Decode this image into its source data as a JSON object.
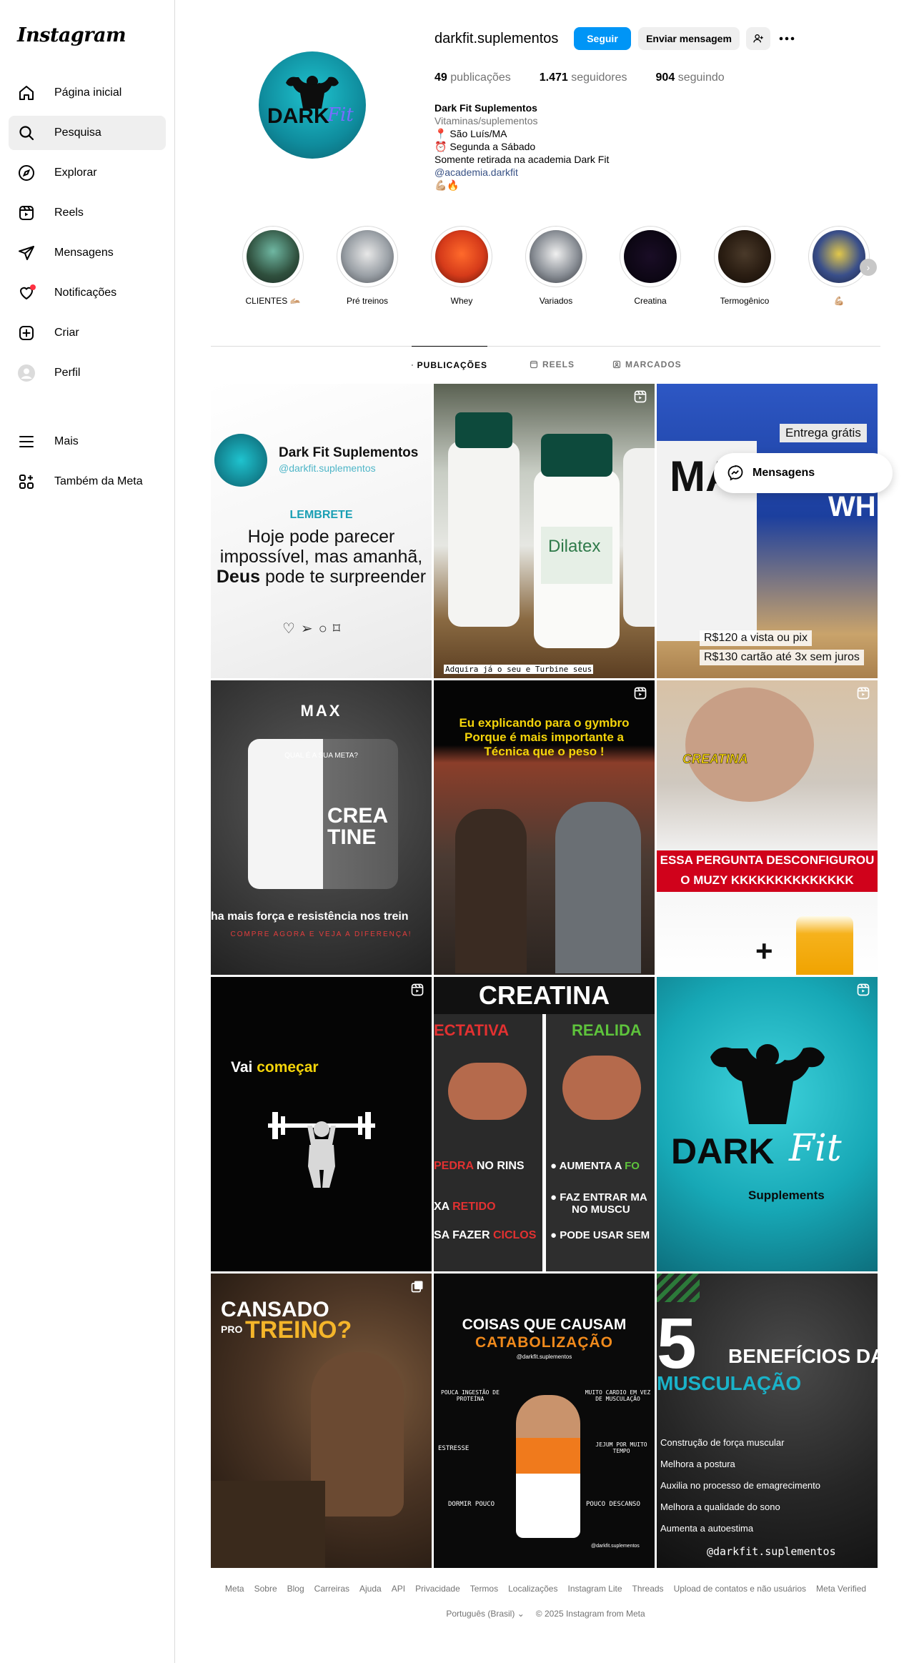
{
  "app": {
    "logo": "Instagram"
  },
  "sidebar": {
    "items": [
      {
        "label": "Página inicial",
        "icon": "home-icon"
      },
      {
        "label": "Pesquisa",
        "icon": "search-icon"
      },
      {
        "label": "Explorar",
        "icon": "compass-icon"
      },
      {
        "label": "Reels",
        "icon": "reels-icon"
      },
      {
        "label": "Mensagens",
        "icon": "send-icon"
      },
      {
        "label": "Notificações",
        "icon": "heart-icon"
      },
      {
        "label": "Criar",
        "icon": "plus-square-icon"
      },
      {
        "label": "Perfil",
        "icon": "avatar"
      },
      {
        "label": "Mais",
        "icon": "menu-icon"
      },
      {
        "label": "Também da Meta",
        "icon": "meta-apps-icon"
      }
    ],
    "active": "Pesquisa"
  },
  "profile": {
    "username": "darkfit.suplementos",
    "follow_label": "Seguir",
    "message_label": "Enviar mensagem",
    "stats": {
      "posts_count": "49",
      "posts_label": "publicações",
      "followers_count": "1.471",
      "followers_label": "seguidores",
      "following_count": "904",
      "following_label": "seguindo"
    },
    "bio": {
      "name": "Dark Fit Suplementos",
      "category": "Vitaminas/suplementos",
      "line1": "📍 São Luís/MA",
      "line2": "⏰ Segunda a Sábado",
      "line3": "Somente retirada na academia Dark Fit",
      "link": "@academia.darkfit",
      "line5": "💪🏼🔥"
    },
    "avatar_text": {
      "dark": "DARK",
      "fit": "Fit"
    }
  },
  "highlights": [
    {
      "label": "CLIENTES 🫴🏼"
    },
    {
      "label": "Pré treinos"
    },
    {
      "label": "Whey"
    },
    {
      "label": "Variados"
    },
    {
      "label": "Creatina"
    },
    {
      "label": "Termogênico"
    },
    {
      "label": "💪🏼"
    }
  ],
  "tabs": [
    {
      "label": "PUBLICAÇÕES",
      "icon": "grid-icon"
    },
    {
      "label": "REELS",
      "icon": "reels-icon"
    },
    {
      "label": "MARCADOS",
      "icon": "tagged-icon"
    }
  ],
  "posts": {
    "p1": {
      "name": "Dark Fit Suplementos",
      "handle": "@darkfit.suplementos",
      "tag": "LEMBRETE",
      "l1": "Hoje pode parecer",
      "l2": "impossível, mas amanhã,",
      "l3a": "Deus",
      "l3b": " pode te surpreender"
    },
    "p2": {
      "caption": "Adquira já o seu e Turbine seus"
    },
    "p3": {
      "badge": "Entrega grátis",
      "price1": "R$120 a vista ou pix",
      "price2": "R$130 cartão até 3x sem juros",
      "brand": "MAX",
      "sub": "WHE"
    },
    "p4": {
      "brand": "MAX",
      "q": "QUAL É A SUA META?",
      "crea": "CREA",
      "tine": "TINE",
      "l1": "ha mais força e resistência nos trein",
      "l2": "COMPRE AGORA E VEJA A DIFERENÇA!"
    },
    "p5": {
      "l1": "Eu explicando para o gymbro",
      "l2": "Porque é mais importante a",
      "l3": "Técnica que o peso !"
    },
    "p6": {
      "tag": "CREATINA",
      "l1": "ESSA PERGUNTA DESCONFIGUROU",
      "l2": "O MUZY KKKKKKKKKKKKKK"
    },
    "p7": {
      "a": "Vai ",
      "b": "começar"
    },
    "p8": {
      "title": "CREATINA",
      "left": "ECTATIVA",
      "right": "REALIDA",
      "r1a": "PEDRA",
      "r1b": " NO RINS",
      "r2a": "XA ",
      "r2b": "RETIDO",
      "r3a": "SA FAZER ",
      "r3b": "CICLOS",
      "s1a": "AUMENTA A ",
      "s1b": "FO",
      "s2": "FAZ ENTRAR MA",
      "s2b": "NO MUSCU",
      "s3": "PODE USAR SEM"
    },
    "p9": {
      "dark": "DARK",
      "fit": "Fit",
      "sub": "Supplements"
    },
    "p10": {
      "l1": "CANSADO",
      "l2": "PRO",
      "l3": "TREINO?"
    },
    "p11": {
      "l1": "COISAS QUE CAUSAM",
      "l2": "CATABOLIZAÇÃO",
      "handle": "@darkfit.suplementos",
      "a": "POUCA INGESTÃO DE PROTEÍNA",
      "b": "MUITO CARDIO EM VEZ DE MUSCULAÇÃO",
      "c": "ESTRESSE",
      "d": "JEJUM POR MUITO TEMPO",
      "e": "DORMIR POUCO",
      "f": "POUCO DESCANSO",
      "handle2": "@darkfit.suplementos"
    },
    "p12": {
      "num": "5",
      "l1": "BENEFÍCIOS DA",
      "l2": "MUSCULAÇÃO",
      "b1": "Construção de força muscular",
      "b2": "Melhora a postura",
      "b3": "Auxilia no processo de emagrecimento",
      "b4": "Melhora a qualidade do sono",
      "b5": "Aumenta a autoestima",
      "handle": "@darkfit.suplementos"
    }
  },
  "floating": {
    "messages_label": "Mensagens"
  },
  "footer": {
    "links": [
      "Meta",
      "Sobre",
      "Blog",
      "Carreiras",
      "Ajuda",
      "API",
      "Privacidade",
      "Termos",
      "Localizações",
      "Instagram Lite",
      "Threads",
      "Upload de contatos e não usuários",
      "Meta Verified"
    ],
    "language": "Português (Brasil)",
    "copyright": "© 2025 Instagram from Meta"
  },
  "colors": {
    "primary": "#0095f6",
    "link": "#385185",
    "muted": "#737373",
    "border": "#dbdbdb"
  }
}
